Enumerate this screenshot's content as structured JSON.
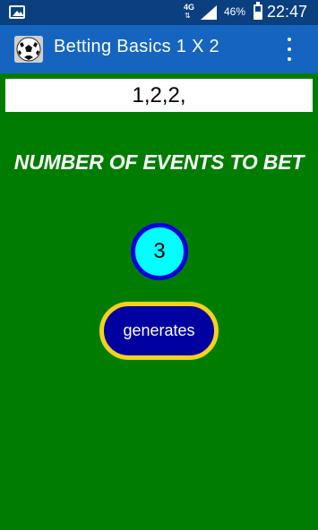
{
  "status_bar": {
    "network": "4G",
    "battery_percent": "46%",
    "time": "22:47",
    "icons": [
      "image-icon",
      "network-arrows-icon",
      "signal-icon",
      "battery-icon"
    ]
  },
  "app_bar": {
    "icon": "soccer-ball-icon",
    "title": "Betting Basics 1 X 2",
    "menu_icon": "overflow-menu-icon"
  },
  "result": {
    "value": "1,2,2,"
  },
  "heading": "NUMBER OF EVENTS TO BET",
  "counter": {
    "value": "3"
  },
  "generate_button": {
    "label": "generates"
  },
  "colors": {
    "background": "#007d00",
    "status_bar": "#0a3f80",
    "app_bar": "#1565c0",
    "counter_fill": "#00ffff",
    "counter_border": "#0000e0",
    "button_fill": "#0000a0",
    "button_border": "#f7d11a"
  }
}
